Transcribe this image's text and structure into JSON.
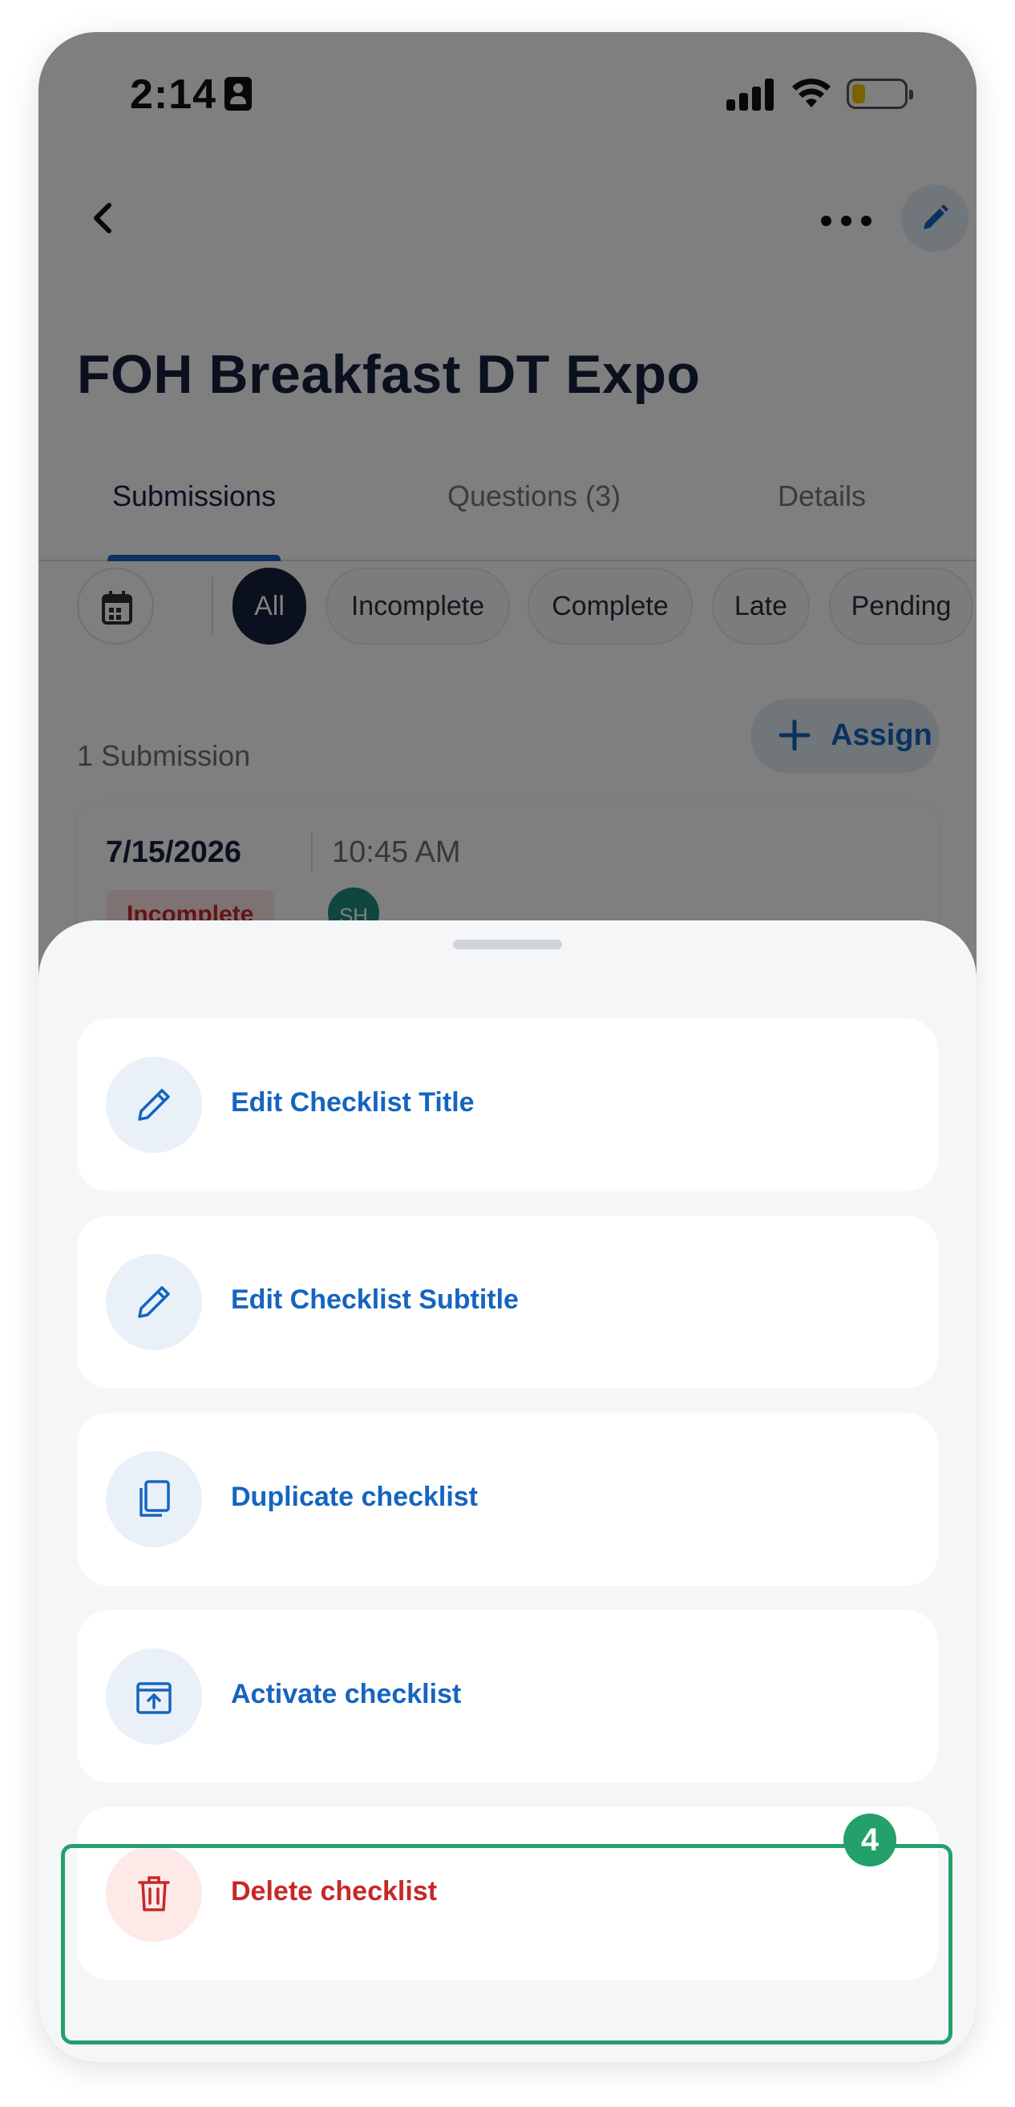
{
  "status_bar": {
    "time": "2:14"
  },
  "header": {
    "title": "FOH Breakfast DT Expo"
  },
  "tabs": [
    {
      "label": "Submissions",
      "active": true
    },
    {
      "label": "Questions (3)",
      "active": false
    },
    {
      "label": "Details",
      "active": false
    }
  ],
  "filters": {
    "chips": [
      {
        "label": "All",
        "active": true
      },
      {
        "label": "Incomplete",
        "active": false
      },
      {
        "label": "Complete",
        "active": false
      },
      {
        "label": "Late",
        "active": false
      },
      {
        "label": "Pending",
        "active": false
      }
    ]
  },
  "submissions": {
    "count_label": "1 Submission",
    "assign_label": "Assign",
    "items": [
      {
        "date": "7/15/2026",
        "time": "10:45 AM",
        "status": "Incomplete",
        "assignee_initials": "SH"
      }
    ]
  },
  "sheet": {
    "items": [
      {
        "label": "Edit Checklist Title",
        "icon": "pencil-icon"
      },
      {
        "label": "Edit Checklist Subtitle",
        "icon": "pencil-icon"
      },
      {
        "label": "Duplicate checklist",
        "icon": "copy-icon"
      },
      {
        "label": "Activate checklist",
        "icon": "archive-upload-icon"
      },
      {
        "label": "Delete checklist",
        "icon": "trash-icon"
      }
    ]
  },
  "annotation": {
    "step": "4"
  },
  "colors": {
    "primary": "#1565c0",
    "danger": "#c62828",
    "highlight": "#24a06b",
    "title": "#14213d"
  }
}
